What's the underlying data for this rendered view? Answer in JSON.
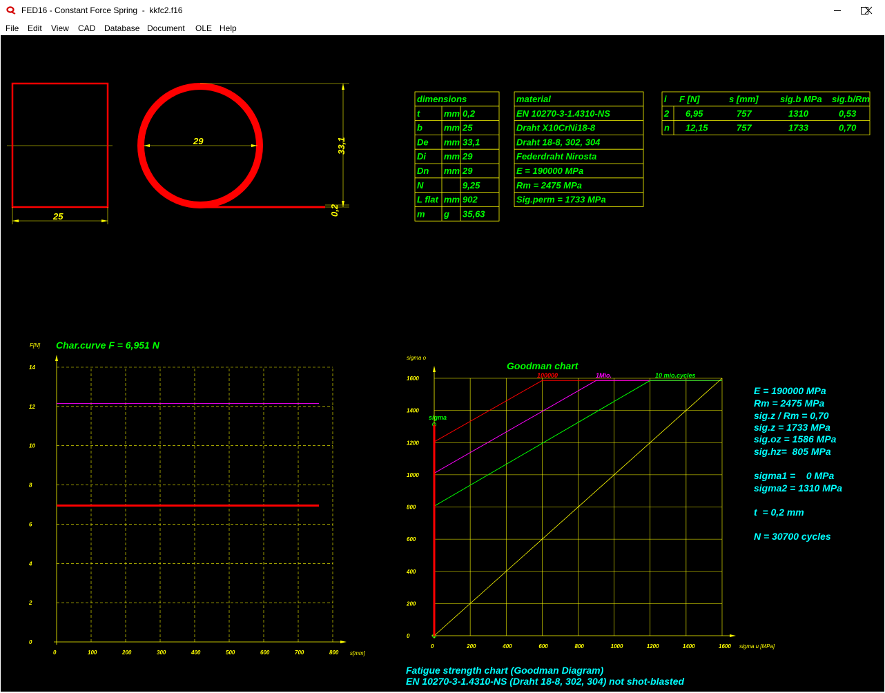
{
  "window": {
    "title": "FED16 - Constant Force Spring  -  kkfc2.f16",
    "controls": [
      "minimize-icon",
      "maximize-icon",
      "close-icon"
    ]
  },
  "menu": [
    "File",
    "Edit",
    "View",
    "CAD",
    "Database",
    "Document",
    "OLE",
    "Help"
  ],
  "drawing": {
    "rect_width_label": "25",
    "inner_diameter_label": "29",
    "outer_diameter_label": "33,1",
    "thickness_label": "0,2"
  },
  "dimensions_table": {
    "header": "dimensions",
    "rows": [
      [
        "t",
        "mm",
        "0,2"
      ],
      [
        "b",
        "mm",
        "25"
      ],
      [
        "De",
        "mm",
        "33,1"
      ],
      [
        "Di",
        "mm",
        "29"
      ],
      [
        "Dn",
        "mm",
        "29"
      ],
      [
        "N",
        "",
        "9,25"
      ],
      [
        "L flat",
        "mm",
        "902"
      ],
      [
        "m",
        "g",
        "35,63"
      ]
    ]
  },
  "material_table": {
    "header": "material",
    "rows": [
      "EN 10270-3-1.4310-NS",
      "Draht X10CrNi18-8",
      "Draht 18-8, 302, 304",
      "Federdraht Nirosta",
      "E = 190000 MPa",
      "Rm = 2475 MPa",
      "Sig.perm = 1733 MPa"
    ]
  },
  "load_table": {
    "headers": [
      "i",
      "F [N]",
      "s [mm]",
      "sig.b MPa",
      "sig.b/Rm"
    ],
    "rows": [
      [
        "2",
        "6,95",
        "757",
        "1310",
        "0,53"
      ],
      [
        "n",
        "12,15",
        "757",
        "1733",
        "0,70"
      ]
    ]
  },
  "char_chart": {
    "title": "Char.curve F = 6,951 N",
    "ylabel": "F[N]",
    "xlabel": "s[mm]",
    "colors": {
      "grid": "#ffff00",
      "series_1": "#ff0000",
      "series_2": "#ff00ff"
    }
  },
  "goodman_chart": {
    "title": "Goodman chart",
    "ylabel": "sigma o",
    "xlabel": "sigma u [MPa]",
    "sigma_label": "sigma",
    "curve_labels": [
      "100000",
      "1Mio.",
      "10 mio.cycles"
    ],
    "params": [
      "E = 190000 MPa",
      "Rm = 2475 MPa",
      "sig.z / Rm = 0,70",
      "sig.z = 1733 MPa",
      "sig.oz = 1586 MPa",
      "sig.hz=  805 MPa",
      "sigma1 =    0 MPa",
      "sigma2 = 1310 MPa",
      "t  = 0,2 mm",
      "N = 30700 cycles"
    ],
    "footer": [
      "Fatigue strength chart (Goodman Diagram)",
      "EN 10270-3-1.4310-NS (Draht 18-8, 302, 304) not shot-blasted"
    ],
    "colors": {
      "grid": "#ffff00",
      "c100k": "#ff0000",
      "c1m": "#ff00ff",
      "c10m": "#00ff00",
      "diag": "#ffff00"
    }
  },
  "chart_data": [
    {
      "type": "line",
      "title": "Char.curve F = 6,951 N",
      "xlabel": "s[mm]",
      "ylabel": "F[N]",
      "xlim": [
        0,
        800
      ],
      "ylim": [
        0,
        14
      ],
      "xticks": [
        0,
        100,
        200,
        300,
        400,
        500,
        600,
        700,
        800
      ],
      "yticks": [
        0,
        2,
        4,
        6,
        8,
        10,
        12,
        14
      ],
      "grid": true,
      "series": [
        {
          "x": [
            0,
            760
          ],
          "y": [
            6.95,
            6.95
          ]
        },
        {
          "x": [
            0,
            760
          ],
          "y": [
            12.15,
            12.15
          ]
        }
      ]
    },
    {
      "type": "line",
      "title": "Goodman chart",
      "xlabel": "sigma u [MPa]",
      "ylabel": "sigma o",
      "xlim": [
        0,
        1600
      ],
      "ylim": [
        0,
        1600
      ],
      "xticks": [
        0,
        200,
        400,
        600,
        800,
        1000,
        1200,
        1400,
        1600
      ],
      "yticks": [
        0,
        200,
        400,
        600,
        800,
        1000,
        1200,
        1400,
        1600
      ],
      "grid": true,
      "series": [
        {
          "name": "100000",
          "x": [
            0,
            600,
            1600
          ],
          "y": [
            1205,
            1586,
            1586
          ]
        },
        {
          "name": "1Mio.",
          "x": [
            0,
            900,
            1600
          ],
          "y": [
            1010,
            1586,
            1586
          ]
        },
        {
          "name": "10 mio.cycles",
          "x": [
            0,
            1200,
            1600
          ],
          "y": [
            805,
            1586,
            1586
          ]
        },
        {
          "x": [
            0,
            1600
          ],
          "y": [
            0,
            1600
          ]
        },
        {
          "x": [
            0,
            0
          ],
          "y": [
            0,
            1310
          ]
        }
      ]
    }
  ]
}
